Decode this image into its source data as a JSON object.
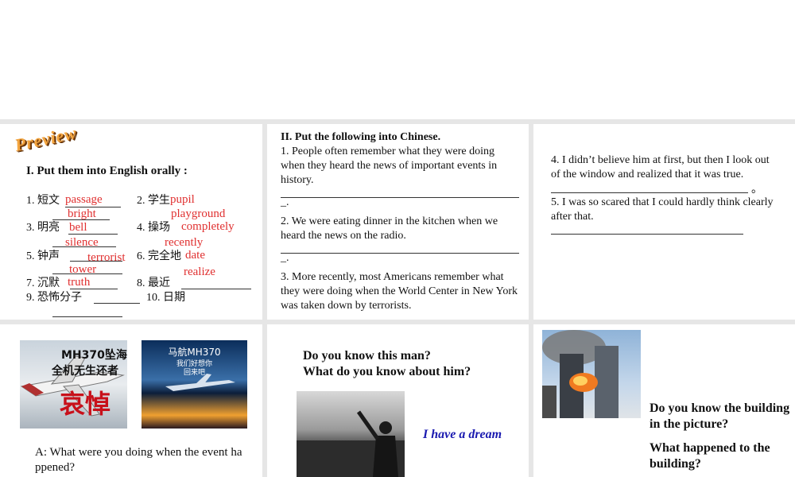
{
  "panel1": {
    "logo": "Preview",
    "heading": "I. Put them into English orally :",
    "items": [
      {
        "num": "1. 短文",
        "answer": "passage"
      },
      {
        "num": "2.  学生",
        "answer": "pupil"
      },
      {
        "num": "3. 明亮",
        "answer": "bright"
      },
      {
        "num": "4.  操场",
        "answer": "playground"
      },
      {
        "num": "5. 钟声",
        "answer": "bell"
      },
      {
        "num": "6.  完全地",
        "answer": "completely"
      },
      {
        "num": "7. 沉默",
        "answer": "silence"
      },
      {
        "num": "8.  最近",
        "answer": "recently"
      },
      {
        "num": "9. 恐怖分子",
        "answer": "terrorist"
      },
      {
        "num": "10. 日期",
        "answer": "date"
      }
    ],
    "extra_answers": [
      "tower",
      "realize",
      "truth"
    ]
  },
  "panel2": {
    "heading": "II. Put the following into Chinese",
    "period": ".",
    "s1": "1. People often remember what they were doing when they heard the news of important events in history.",
    "s2": "2. We were eating dinner in the kitchen when we heard the news on the radio.",
    "s3": "3. More recently, most Americans remember what they were doing when the World Center in New York was taken down by terrorists.",
    "blank_end": "_."
  },
  "panel3": {
    "s4": "4. I didn’t believe him at first, but then I look out of the window and realized that it was true.",
    "s4_end": "。",
    "s5": "5. I was so scared that I could hardly think clearly after that."
  },
  "panel4": {
    "img1_title1": "MH370坠海",
    "img1_title2": "全机无生还者",
    "img1_big": "哀悼",
    "img2_title": "马航MH370",
    "img2_sub1": "我们好想你",
    "img2_sub2": "回来吧",
    "question": "A: What were you doing when the event happened?"
  },
  "panel5": {
    "q1": "Do you know this man?",
    "q2": "What do you know about him?",
    "quote": "I have a dream"
  },
  "panel6": {
    "q1": "Do you know the building in the picture?",
    "q2": "What happened to the building?"
  },
  "colors": {
    "answer_red": "#e03030",
    "quote_blue": "#1a1ab0",
    "divider": "#e6e6e6"
  }
}
